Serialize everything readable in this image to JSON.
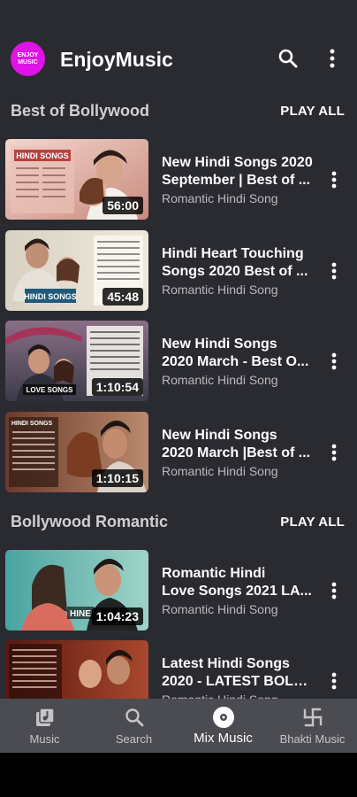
{
  "header": {
    "logo_line1": "ENJOY",
    "logo_line2": "MUSIC",
    "title": "EnjoyMusic",
    "search_icon": "search-icon",
    "more_icon": "more-vert-icon"
  },
  "sections": [
    {
      "title": "Best of Bollywood",
      "play_all": "PLAY ALL",
      "videos": [
        {
          "title_line1": "New Hindi Songs 2020",
          "title_line2": "September | Best of ...",
          "subtitle": "Romantic Hindi Song",
          "duration": "56:00",
          "thumb_text": "HINDI SONGS"
        },
        {
          "title_line1": "Hindi Heart Touching",
          "title_line2": "Songs 2020 Best of ...",
          "subtitle": "Romantic Hindi Song",
          "duration": "45:48",
          "thumb_text": "HINDI SONGS"
        },
        {
          "title_line1": "New Hindi Songs",
          "title_line2": "2020 March - Best O...",
          "subtitle": "Romantic Hindi Song",
          "duration": "1:10:54",
          "thumb_text": "LOVE SONGS"
        },
        {
          "title_line1": "New Hindi Songs",
          "title_line2": "2020 March |Best of ...",
          "subtitle": "Romantic Hindi Song",
          "duration": "1:10:15",
          "thumb_text": "HINDI SONGS"
        }
      ]
    },
    {
      "title": "Bollywood Romantic",
      "play_all": "PLAY ALL",
      "videos": [
        {
          "title_line1": "Romantic Hindi",
          "title_line2": "Love Songs 2021 LA...",
          "subtitle": "Romantic Hindi Song",
          "duration": "1:04:23",
          "thumb_text": "HINE"
        },
        {
          "title_line1": "Latest Hindi Songs",
          "title_line2": "2020 - LATEST BOLL...",
          "subtitle": "Romantic Hindi Song",
          "duration": "",
          "thumb_text": ""
        }
      ]
    }
  ],
  "bottom_nav": [
    {
      "label": "Music",
      "icon": "music-library-icon",
      "active": false
    },
    {
      "label": "Search",
      "icon": "search-icon",
      "active": false
    },
    {
      "label": "Mix Music",
      "icon": "disc-icon",
      "active": true
    },
    {
      "label": "Bhakti Music",
      "icon": "swastika-icon",
      "active": false
    }
  ],
  "colors": {
    "background": "#2a2a31",
    "nav_background": "#4b4b52",
    "logo": "#e012e6",
    "text": "#ffffff",
    "subtext": "#b9b9bf"
  }
}
